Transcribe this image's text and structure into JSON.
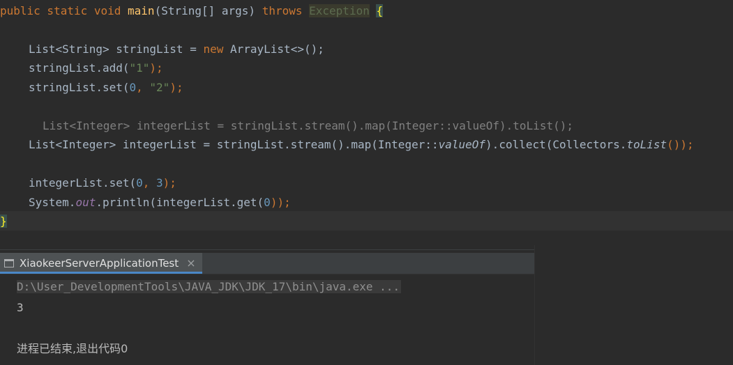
{
  "editor": {
    "line1": {
      "kw1": "public static void",
      "method": "main",
      "params": "(String[] args)",
      "throws": "throws",
      "exception": "Exception",
      "brace": "{"
    },
    "line3": {
      "decl": "List<String> stringList = ",
      "new": "new",
      "rest": " ArrayList<>();"
    },
    "line4": {
      "pre": "stringList.add(",
      "str": "\"1\"",
      "post": ");"
    },
    "line5": {
      "pre": "stringList.set(",
      "num": "0",
      "sep": ", ",
      "str": "\"2\"",
      "post": ");"
    },
    "line7": {
      "hint": "List<Integer> integerList = stringList.stream().map(Integer::valueOf).toList();"
    },
    "line8": {
      "pre": "List<Integer> integerList = stringList.stream().map(Integer::",
      "valueOf": "valueOf",
      "mid": ").collect(Collectors.",
      "toList": "toList",
      "post": "());"
    },
    "line10": {
      "pre": "integerList.set(",
      "num1": "0",
      "sep": ", ",
      "num2": "3",
      "post": ");"
    },
    "line11": {
      "pre": "System.",
      "out": "out",
      "mid": ".println(integerList.get(",
      "num": "0",
      "post": "));"
    },
    "line12": {
      "brace": "}"
    }
  },
  "run_panel": {
    "tab_label": "XiaokeerServerApplicationTest",
    "tab_close": "×",
    "command": "D:\\User_DevelopmentTools\\JAVA_JDK\\JDK_17\\bin\\java.exe ...",
    "output_value": "3",
    "exit_message": "进程已结束,退出代码0"
  },
  "colors": {
    "background": "#2b2b2b",
    "keyword": "#cc7832",
    "method": "#ffc66d",
    "string": "#6a8759",
    "number": "#6897bb",
    "static_field": "#9876aa",
    "tab_accent": "#4a88c7"
  },
  "icons": {
    "tab": "run-console-icon",
    "close": "close-icon"
  }
}
